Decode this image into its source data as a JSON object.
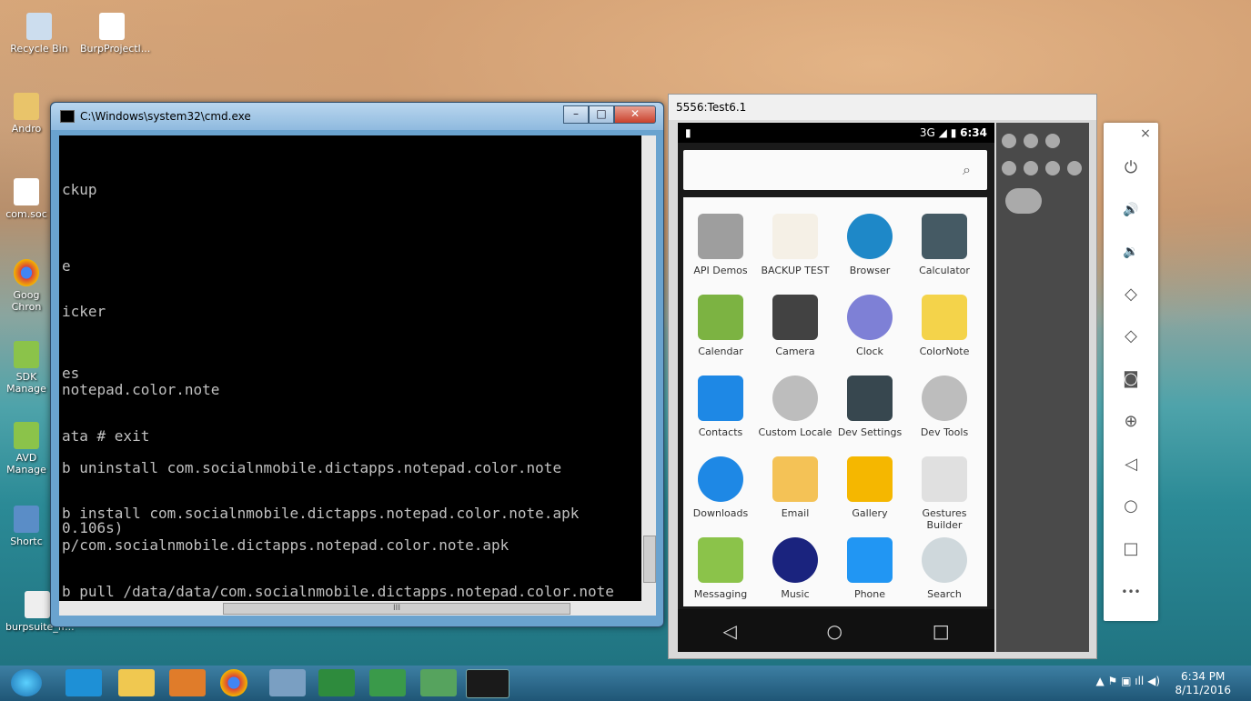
{
  "desktop": {
    "icons": [
      {
        "label": "Recycle Bin"
      },
      {
        "label": "BurpProjectl..."
      },
      {
        "label": "Andro"
      },
      {
        "label": "com.soc"
      },
      {
        "label": "Goog Chron"
      },
      {
        "label": "SDK Manage"
      },
      {
        "label": "AVD Manage"
      },
      {
        "label": "Shortc"
      },
      {
        "label": "burpsuite_fr..."
      }
    ]
  },
  "cmd": {
    "title": "C:\\Windows\\system32\\cmd.exe",
    "minimize": "–",
    "maximize": "□",
    "close": "✕",
    "lines": [
      "ckup",
      "e",
      "icker",
      "es",
      "notepad.color.note",
      "ata # exit",
      "b uninstall com.socialnmobile.dictapps.notepad.color.note",
      "b install com.socialnmobile.dictapps.notepad.color.note.apk",
      "0.106s)",
      "p/com.socialnmobile.dictapps.notepad.color.note.apk",
      "b pull /data/data/com.socialnmobile.dictapps.notepad.color.note"
    ],
    "hscroll_thumb": "III"
  },
  "emulator": {
    "title": "5556:Test6.1",
    "status_time": "6:34",
    "status_signal": "3G",
    "apps": [
      {
        "label": "API Demos",
        "color": "#9e9e9e"
      },
      {
        "label": "BACKUP TEST",
        "color": "#f5f0e6"
      },
      {
        "label": "Browser",
        "color": "#1e88c8"
      },
      {
        "label": "Calculator",
        "color": "#455a64"
      },
      {
        "label": "Calendar",
        "color": "#7cb342"
      },
      {
        "label": "Camera",
        "color": "#424242"
      },
      {
        "label": "Clock",
        "color": "#7e80d6"
      },
      {
        "label": "ColorNote",
        "color": "#f4d34a"
      },
      {
        "label": "Contacts",
        "color": "#1e88e5"
      },
      {
        "label": "Custom Locale",
        "color": "#bdbdbd"
      },
      {
        "label": "Dev Settings",
        "color": "#37474f"
      },
      {
        "label": "Dev Tools",
        "color": "#bdbdbd"
      },
      {
        "label": "Downloads",
        "color": "#1e88e5"
      },
      {
        "label": "Email",
        "color": "#f4c256"
      },
      {
        "label": "Gallery",
        "color": "#f5b700"
      },
      {
        "label": "Gestures Builder",
        "color": "#e0e0e0"
      },
      {
        "label": "Messaging",
        "color": "#8bc34a"
      },
      {
        "label": "Music",
        "color": "#1a237e"
      },
      {
        "label": "Phone",
        "color": "#2196f3"
      },
      {
        "label": "Search",
        "color": "#cfd8dc"
      }
    ],
    "nav": {
      "back": "◁",
      "home": "○",
      "recents": "□"
    }
  },
  "toolbar": {
    "close": "×",
    "buttons": [
      {
        "name": "power-icon",
        "glyph": "⏻"
      },
      {
        "name": "volume-up-icon",
        "glyph": "🔊"
      },
      {
        "name": "volume-down-icon",
        "glyph": "🔉"
      },
      {
        "name": "rotate-left-icon",
        "glyph": "◇"
      },
      {
        "name": "rotate-right-icon",
        "glyph": "◇"
      },
      {
        "name": "camera-icon",
        "glyph": "◙"
      },
      {
        "name": "zoom-icon",
        "glyph": "⊕"
      },
      {
        "name": "back-icon",
        "glyph": "◁"
      },
      {
        "name": "home-icon",
        "glyph": "○"
      },
      {
        "name": "overview-icon",
        "glyph": "□"
      },
      {
        "name": "more-icon",
        "glyph": "•••"
      }
    ]
  },
  "taskbar": {
    "time": "6:34 PM",
    "date": "8/11/2016",
    "tray_icons": "▲ ⚑ ▣ ıll ◀)"
  }
}
